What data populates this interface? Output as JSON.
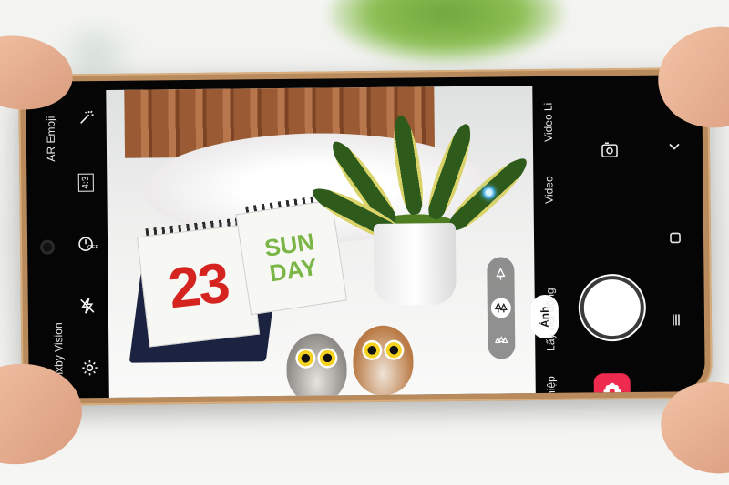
{
  "left_rail": {
    "ar_emoji_label": "AR Emoji",
    "aspect_ratio": "4:3",
    "timer_label": "OFF",
    "bixby_vision_label": "Bixby Vision"
  },
  "viewfinder": {
    "calendar_day": "23",
    "calendar_weekday": "SUN\nDAY"
  },
  "modes": {
    "video_live_label": "Video Li",
    "video_label": "Video",
    "photo_label": "Ảnh",
    "live_focus_label": "Lấy nét động",
    "more_label": "hiệp"
  },
  "colors": {
    "gallery_accent": "#ee2a4f",
    "shutter": "#ffffff",
    "zoom_active": "#ffffff"
  }
}
